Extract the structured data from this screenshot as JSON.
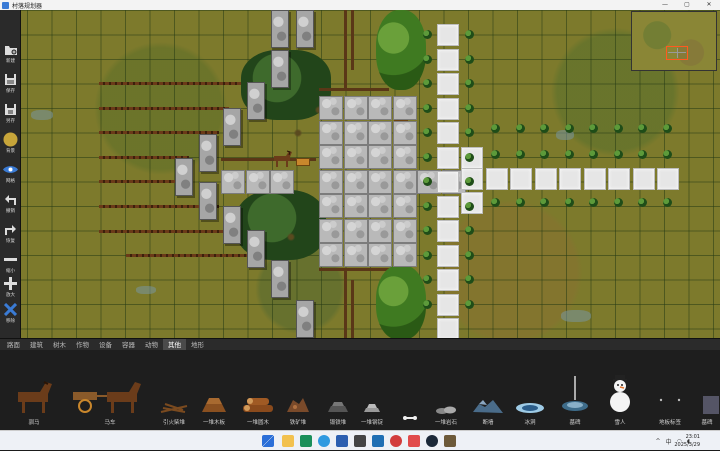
{
  "window": {
    "title": "村落规划器",
    "min_glyph": "—",
    "max_glyph": "▢",
    "close_glyph": "✕"
  },
  "toolbar": [
    {
      "label": "新建",
      "icon": "folder-add-icon"
    },
    {
      "label": "保存",
      "icon": "save-icon"
    },
    {
      "label": "另存",
      "icon": "save-as-icon"
    },
    {
      "label": "背景",
      "icon": "background-circle-icon"
    },
    {
      "label": "网格",
      "icon": "eye-icon"
    },
    {
      "label": "撤销",
      "icon": "undo-icon"
    },
    {
      "label": "恢复",
      "icon": "redo-icon"
    },
    {
      "label": "缩小",
      "icon": "minus-icon"
    },
    {
      "label": "放大",
      "icon": "plus-icon"
    },
    {
      "label": "移除",
      "icon": "remove-x-icon"
    }
  ],
  "tabs": [
    "路面",
    "建筑",
    "树木",
    "作物",
    "设备",
    "容器",
    "动物",
    "其他",
    "地形"
  ],
  "active_tab": "其他",
  "palette": [
    {
      "label": "驯马",
      "icon": "horse-icon"
    },
    {
      "label": "马车",
      "icon": "horse-cart-icon"
    },
    {
      "label": "引火柴堆",
      "icon": "kindling-pile-icon"
    },
    {
      "label": "一堆木板",
      "icon": "plank-pile-icon"
    },
    {
      "label": "一堆圆木",
      "icon": "log-pile-icon"
    },
    {
      "label": "铁矿堆",
      "icon": "iron-ore-pile-icon"
    },
    {
      "label": "锻铁堆",
      "icon": "wrought-iron-pile-icon"
    },
    {
      "label": "一堆钢锭",
      "icon": "steel-ingot-pile-icon"
    },
    {
      "label": "",
      "icon": "bone-icon"
    },
    {
      "label": "一堆岩石",
      "icon": "rock-pile-icon"
    },
    {
      "label": "断墙",
      "icon": "broken-wall-icon"
    },
    {
      "label": "冰洞",
      "icon": "ice-hole-icon"
    },
    {
      "label": "墓碑",
      "icon": "tombstone-icon"
    },
    {
      "label": "雪人",
      "icon": "snowman-icon"
    },
    {
      "label": "地板标签",
      "icon": "floor-tag-icon"
    },
    {
      "label": "墓碑",
      "icon": "grave-icon"
    }
  ],
  "taskbar": {
    "tray_caret": "^",
    "tray_lang": "中",
    "time": "23:01",
    "date": "2025/3/29"
  },
  "colors": {
    "accent": "#3a7bd5",
    "minimap_viewport": "#ff5a1f",
    "grass": "#7d7a2c"
  }
}
